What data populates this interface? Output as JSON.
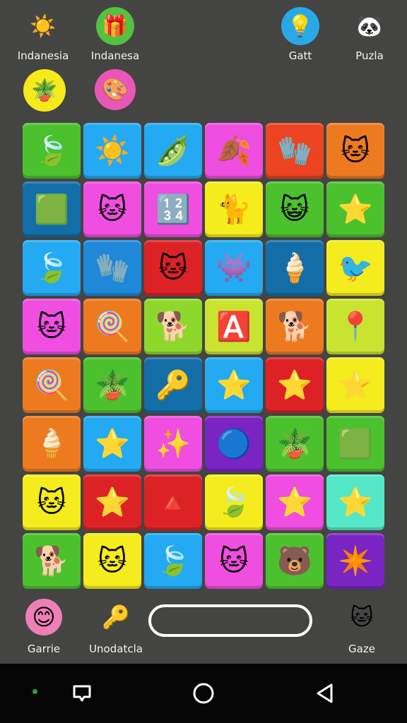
{
  "top_icons": [
    {
      "label": "Indanesia",
      "icon": "sun-icon",
      "glyph": "☀️",
      "bg": "transparent"
    },
    {
      "label": "Indanesa",
      "icon": "gift-box-icon",
      "glyph": "🎁",
      "bg": "#53c241"
    },
    {
      "label": "Gatt",
      "icon": "lightbulb-icon",
      "glyph": "💡",
      "bg": "#29a8e8"
    },
    {
      "label": "Puzla",
      "icon": "red-panda-icon",
      "glyph": "🐼",
      "bg": "transparent"
    },
    {
      "label": "",
      "icon": "potted-plant-icon",
      "glyph": "🪴",
      "bg": "#f6ea1c"
    },
    {
      "label": "",
      "icon": "pink-blob-icon",
      "glyph": "🎨",
      "bg": "#e857b4"
    }
  ],
  "grid": [
    [
      {
        "c": "#4cc12e",
        "i": "leaf",
        "g": "🍃"
      },
      {
        "c": "#23aaf2",
        "i": "sun",
        "g": "☀️"
      },
      {
        "c": "#23aaf2",
        "i": "pea-pod",
        "g": "🫛"
      },
      {
        "c": "#ef4ee0",
        "i": "yellow-leaf",
        "g": "🍂"
      },
      {
        "c": "#ec4321",
        "i": "red-glove",
        "g": "🧤"
      },
      {
        "c": "#ee7a20",
        "i": "white-cat",
        "g": "🐱"
      }
    ],
    [
      {
        "c": "#136ea8",
        "i": "green-square",
        "g": "🟩"
      },
      {
        "c": "#ef4ee0",
        "i": "orange-cat",
        "g": "🐱"
      },
      {
        "c": "#ef4ee0",
        "i": "dot-grid",
        "g": "🔢"
      },
      {
        "c": "#f4ec1c",
        "i": "pink-cat",
        "g": "🐈"
      },
      {
        "c": "#4cc12e",
        "i": "pink-cat-face",
        "g": "😺"
      },
      {
        "c": "#4cc12e",
        "i": "purple-star",
        "g": "⭐"
      }
    ],
    [
      {
        "c": "#23aaf2",
        "i": "green-leaf",
        "g": "🍃"
      },
      {
        "c": "#1f88d8",
        "i": "red-glove",
        "g": "🧤"
      },
      {
        "c": "#dd2226",
        "i": "blue-cat",
        "g": "🐱"
      },
      {
        "c": "#23aaf2",
        "i": "pink-blob",
        "g": "👾"
      },
      {
        "c": "#136ea8",
        "i": "purple-cone",
        "g": "🍦"
      },
      {
        "c": "#f4ec1c",
        "i": "bird",
        "g": "🐦"
      }
    ],
    [
      {
        "c": "#ef4ee0",
        "i": "calico-cat",
        "g": "🐱"
      },
      {
        "c": "#ee7a20",
        "i": "pink-candy-cane",
        "g": "🍭"
      },
      {
        "c": "#8ed82b",
        "i": "brown-dog",
        "g": "🐕"
      },
      {
        "c": "#c8e430",
        "i": "letter-a",
        "g": "🅰️"
      },
      {
        "c": "#ee7a20",
        "i": "pink-dog",
        "g": "🐕"
      },
      {
        "c": "#c8e430",
        "i": "orange-pin",
        "g": "📍"
      }
    ],
    [
      {
        "c": "#ee7a20",
        "i": "pink-candy-cane",
        "g": "🍭"
      },
      {
        "c": "#4cc12e",
        "i": "potted-plant",
        "g": "🪴"
      },
      {
        "c": "#136ea8",
        "i": "blue-key",
        "g": "🔑"
      },
      {
        "c": "#23aaf2",
        "i": "yellow-star",
        "g": "⭐"
      },
      {
        "c": "#dd2226",
        "i": "purple-star",
        "g": "⭐"
      },
      {
        "c": "#f4ec1c",
        "i": "orange-star",
        "g": "⭐"
      }
    ],
    [
      {
        "c": "#ee7a20",
        "i": "purple-cone",
        "g": "🍦"
      },
      {
        "c": "#23aaf2",
        "i": "yellow-star",
        "g": "⭐"
      },
      {
        "c": "#ef4ee0",
        "i": "gold-sparkle",
        "g": "✨"
      },
      {
        "c": "#7a24c4",
        "i": "blue-ring",
        "g": "🔵"
      },
      {
        "c": "#4cc12e",
        "i": "potted-plant",
        "g": "🪴"
      },
      {
        "c": "#4cc12e",
        "i": "green-square",
        "g": "🟩"
      }
    ],
    [
      {
        "c": "#f4ec1c",
        "i": "tabby-cat",
        "g": "🐱"
      },
      {
        "c": "#dd2226",
        "i": "yellow-star",
        "g": "⭐"
      },
      {
        "c": "#dd2226",
        "i": "orange-triangle",
        "g": "🔺"
      },
      {
        "c": "#f4ec1c",
        "i": "green-leaf",
        "g": "🍃"
      },
      {
        "c": "#ef4ee0",
        "i": "purple-star",
        "g": "⭐"
      },
      {
        "c": "#55e8c8",
        "i": "white-star",
        "g": "⭐"
      }
    ],
    [
      {
        "c": "#4cc12e",
        "i": "black-dog",
        "g": "🐕"
      },
      {
        "c": "#f4ec1c",
        "i": "tabby-cat",
        "g": "🐱"
      },
      {
        "c": "#23aaf2",
        "i": "green-leaf",
        "g": "🍃"
      },
      {
        "c": "#ef4ee0",
        "i": "blue-cat",
        "g": "🐱"
      },
      {
        "c": "#4cc12e",
        "i": "white-bear",
        "g": "🐻"
      },
      {
        "c": "#7a24c4",
        "i": "yellow-x-star",
        "g": "✴️"
      }
    ]
  ],
  "bottom": {
    "left": {
      "label": "Garrie",
      "icon": "pink-face-icon",
      "glyph": "😊"
    },
    "middle": {
      "label": "Unodatcla",
      "icon": "white-key-icon",
      "glyph": "🔑"
    },
    "right": {
      "label": "Gaze",
      "icon": "white-cat-icon",
      "glyph": "🐱"
    }
  }
}
